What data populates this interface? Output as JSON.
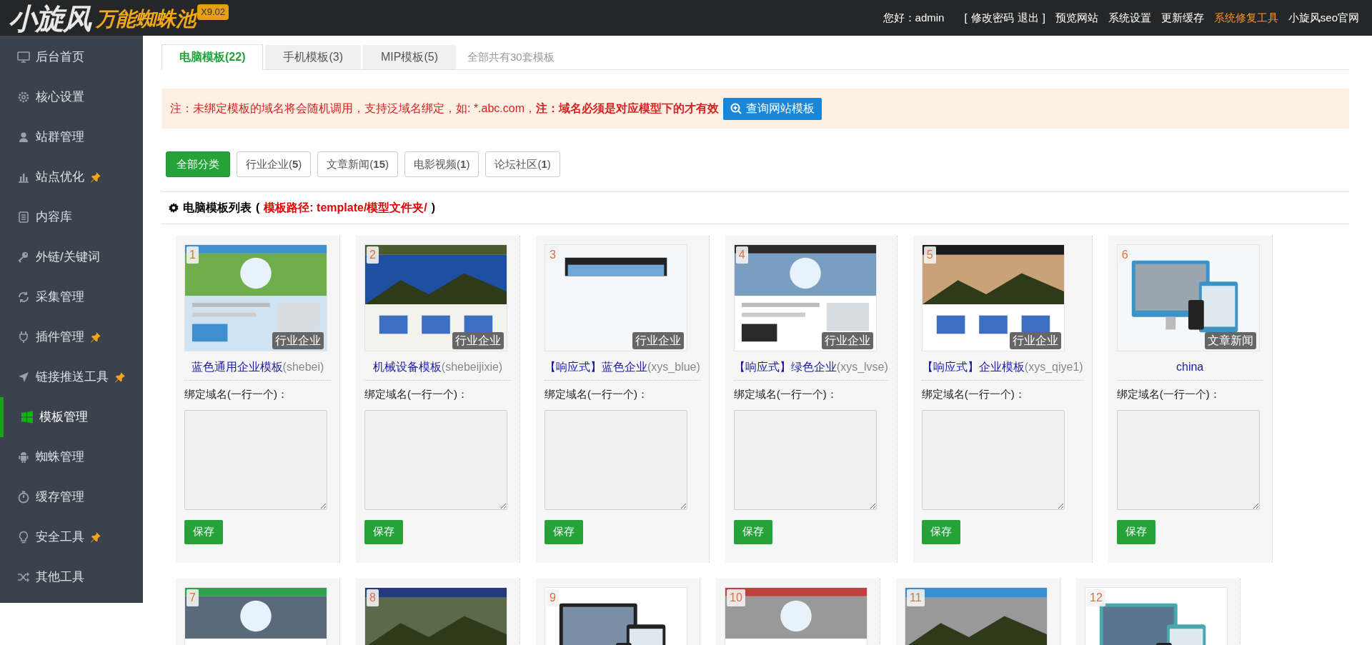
{
  "header": {
    "logo": {
      "title": "小旋风",
      "subtitle": "万能蜘蛛池",
      "version": "X9.02"
    },
    "user": {
      "greeting": "您好：admin",
      "open": "[",
      "links": [
        "修改密码",
        "退出"
      ],
      "close": "]"
    },
    "nav": [
      {
        "label": "预览网站",
        "highlighted": false
      },
      {
        "label": "系统设置",
        "highlighted": false
      },
      {
        "label": "更新缓存",
        "highlighted": false
      },
      {
        "label": "系统修复工具",
        "highlighted": true
      },
      {
        "label": "小旋风seo官网",
        "highlighted": false
      }
    ]
  },
  "sidebar": {
    "items": [
      {
        "label": "后台首页",
        "pinned": false,
        "selected": false
      },
      {
        "label": "核心设置",
        "pinned": false,
        "selected": false
      },
      {
        "label": "站群管理",
        "pinned": false,
        "selected": false
      },
      {
        "label": "站点优化",
        "pinned": true,
        "selected": false
      },
      {
        "label": "内容库",
        "pinned": false,
        "selected": false
      },
      {
        "label": "外链/关键词",
        "pinned": false,
        "selected": false
      },
      {
        "label": "采集管理",
        "pinned": false,
        "selected": false
      },
      {
        "label": "插件管理",
        "pinned": true,
        "selected": false
      },
      {
        "label": "链接推送工具",
        "pinned": true,
        "selected": false
      },
      {
        "label": "模板管理",
        "pinned": false,
        "selected": true
      },
      {
        "label": "蜘蛛管理",
        "pinned": false,
        "selected": false
      },
      {
        "label": "缓存管理",
        "pinned": false,
        "selected": false
      },
      {
        "label": "安全工具",
        "pinned": true,
        "selected": false
      },
      {
        "label": "其他工具",
        "pinned": false,
        "selected": false
      }
    ]
  },
  "tabs": [
    {
      "label": "电脑模板(22)",
      "selected": true
    },
    {
      "label": "手机模板(3)",
      "selected": false
    },
    {
      "label": "MIP模板(5)",
      "selected": false
    }
  ],
  "tabs_note": "全部共有30套模板",
  "notice": {
    "text": "注：未绑定模板的域名将会随机调用，支持泛域名绑定，如: *.abc.com，**注：域名必须是对应模型下的才有效**",
    "button": "查询网站模板"
  },
  "filters": [
    {
      "label": "全部分类",
      "selected": true
    },
    {
      "label": "行业企业(**5**)",
      "selected": false
    },
    {
      "label": "文章新闻(**15**)",
      "selected": false
    },
    {
      "label": "电影视频(**1**)",
      "selected": false
    },
    {
      "label": "论坛社区(**1**)",
      "selected": false
    }
  ],
  "section": {
    "title": "电脑模板列表",
    "open": "(",
    "path": "模板路径: template/模型文件夹/",
    "close": ")"
  },
  "cards": [
    {
      "number": "1",
      "category": "行业企业",
      "name": "蓝色通用企业模板",
      "code": "(shebei)",
      "field_label": "绑定域名(一行一个)：",
      "button": "保存"
    },
    {
      "number": "2",
      "category": "行业企业",
      "name": "机械设备模板",
      "code": "(shebeijixie)",
      "field_label": "绑定域名(一行一个)：",
      "button": "保存"
    },
    {
      "number": "3",
      "category": "行业企业",
      "name": "【响应式】蓝色企业",
      "code": "(xys_blue)",
      "field_label": "绑定域名(一行一个)：",
      "button": "保存"
    },
    {
      "number": "4",
      "category": "行业企业",
      "name": "【响应式】绿色企业",
      "code": "(xys_lvse)",
      "field_label": "绑定域名(一行一个)：",
      "button": "保存"
    },
    {
      "number": "5",
      "category": "行业企业",
      "name": "【响应式】企业模板",
      "code": "(xys_qiye1)",
      "field_label": "绑定域名(一行一个)：",
      "button": "保存"
    },
    {
      "number": "6",
      "category": "文章新闻",
      "name": "china",
      "field_label": "绑定域名(一行一个)：",
      "button": "保存"
    },
    {
      "number": "7"
    },
    {
      "number": "8"
    },
    {
      "number": "9"
    },
    {
      "number": "10"
    },
    {
      "number": "11"
    },
    {
      "number": "12"
    }
  ]
}
